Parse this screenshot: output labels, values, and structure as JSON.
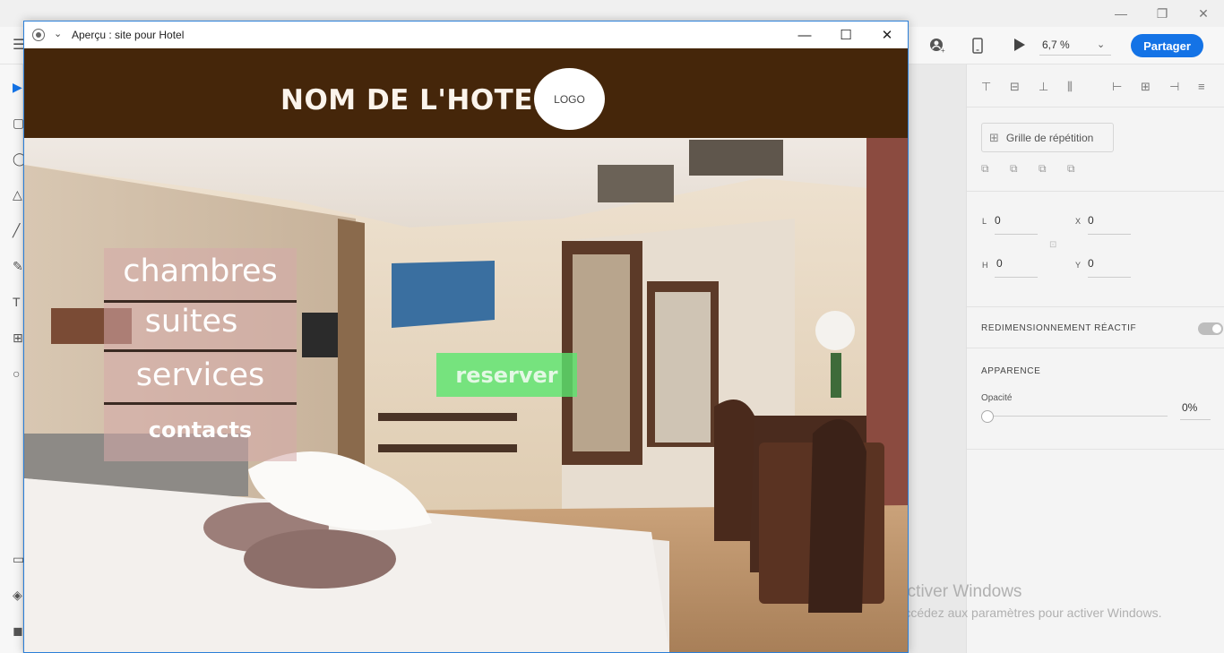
{
  "app": {
    "zoom": "6,7 %",
    "share_label": "Partager"
  },
  "preview": {
    "window_title": "Aperçu : site pour Hotel"
  },
  "site": {
    "hotel_name": "NOM DE L'HOTEL",
    "logo_text": "LOGO",
    "menu": [
      {
        "label": "chambres"
      },
      {
        "label": "suites"
      },
      {
        "label": "services"
      },
      {
        "label": "contacts"
      }
    ],
    "reserve_label": "reserver"
  },
  "panel": {
    "repeat_grid_label": "Grille de répétition",
    "w_label": "L",
    "w_value": "0",
    "x_label": "X",
    "x_value": "0",
    "h_label": "H",
    "h_value": "0",
    "y_label": "Y",
    "y_value": "0",
    "responsive_resize_label": "REDIMENSIONNEMENT RÉACTIF",
    "responsive_resize_on": true,
    "appearance_label": "APPARENCE",
    "opacity_label": "Opacité",
    "opacity_value": "0%"
  },
  "watermark": {
    "line1": "Activer Windows",
    "line2": "Accédez aux paramètres pour activer Windows."
  },
  "colors": {
    "header_brown": "#45260a",
    "share_blue": "#1473e6",
    "reserve_green": "#5ae66e",
    "menu_pink": "#d6aaaa"
  }
}
